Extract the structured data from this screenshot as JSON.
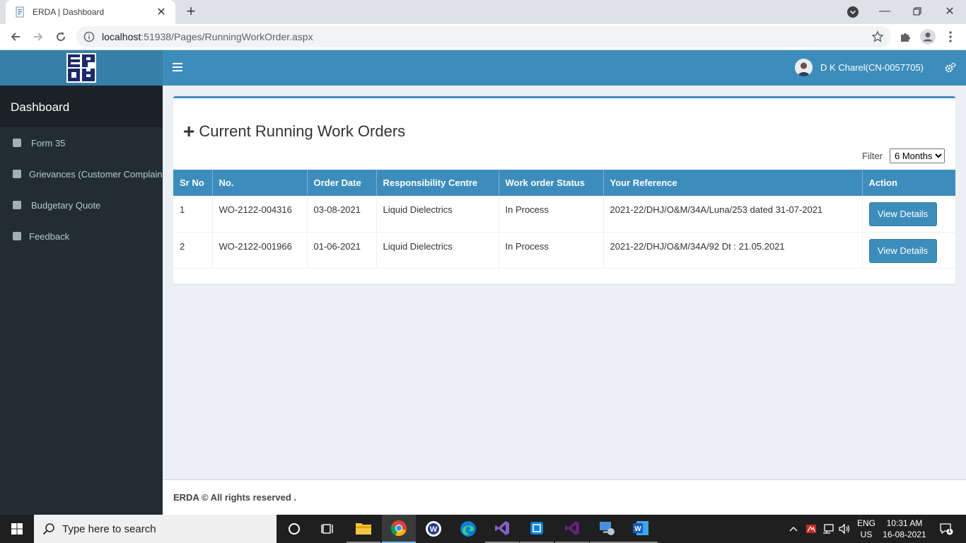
{
  "browser": {
    "tab_title": "ERDA | Dashboard",
    "url_host": "localhost",
    "url_rest": ":51938/Pages/RunningWorkOrder.aspx"
  },
  "header": {
    "user_name": "D K Charel(CN-0057705)"
  },
  "sidebar": {
    "title": "Dashboard",
    "items": [
      {
        "label": "Form 35"
      },
      {
        "label": "Grievances (Customer Complaint)"
      },
      {
        "label": "Budgetary Quote"
      },
      {
        "label": "Feedback"
      }
    ]
  },
  "main": {
    "title": "Current Running Work Orders",
    "filter_label": "Filter",
    "filter_selected": "6 Months",
    "table": {
      "columns": [
        "Sr No",
        "No.",
        "Order Date",
        "Responsibility Centre",
        "Work order Status",
        "Your Reference",
        "Action"
      ],
      "rows": [
        {
          "sr": "1",
          "no": "WO-2122-004316",
          "date": "03-08-2021",
          "centre": "Liquid Dielectrics",
          "status": "In Process",
          "reference": "2021-22/DHJ/O&M/34A/Luna/253 dated 31-07-2021",
          "action": "View Details"
        },
        {
          "sr": "2",
          "no": "WO-2122-001966",
          "date": "01-06-2021",
          "centre": "Liquid Dielectrics",
          "status": "In Process",
          "reference": "2021-22/DHJ/O&M/34A/92 Dt : 21.05.2021",
          "action": "View Details"
        }
      ]
    }
  },
  "footer": {
    "text": "ERDA © All rights reserved ."
  },
  "taskbar": {
    "search_placeholder": "Type here to search",
    "lang_top": "ENG",
    "lang_bottom": "US",
    "time": "10:31 AM",
    "date": "16-08-2021",
    "notifications": "1"
  }
}
